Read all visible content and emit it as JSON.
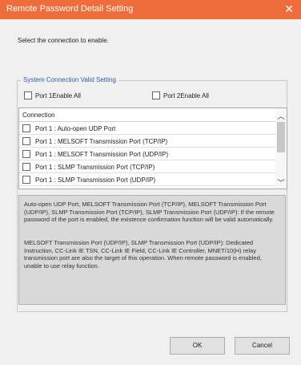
{
  "dialog": {
    "title": "Remote Password Detail Setting",
    "instruction": "Select the connection to enable."
  },
  "group": {
    "title": "System Connection Valid Setting",
    "port1_all_label": "Port 1Enable All",
    "port2_all_label": "Port 2Enable All"
  },
  "list": {
    "header": "Connection",
    "items": [
      {
        "label": "Port 1 : Auto-open UDP Port",
        "checked": false
      },
      {
        "label": "Port 1 : MELSOFT Transmission Port (TCP/IP)",
        "checked": false
      },
      {
        "label": "Port 1 : MELSOFT Transmission Port (UDP/IP)",
        "checked": false
      },
      {
        "label": "Port 1 : SLMP Transmission Port (TCP/IP)",
        "checked": false
      },
      {
        "label": "Port 1 : SLMP Transmission Port (UDP/IP)",
        "checked": false
      }
    ]
  },
  "description": {
    "p1": "Auto-open UDP Port, MELSOFT Transmission Port (TCP/IP), MELSOFT Transmission Port (UDP/IP), SLMP Transmission Port (TCP/IP), SLMP Transmission Port (UDP/IP): If the remote password of the port is enabled, the existence confirmation function will be valid automatically.",
    "p2": "MELSOFT Transmission Port (UDP/IP), SLMP Transmission Port (UDP/IP): Dedicated Instruction, CC-Link IE TSN, CC-Link IE Field, CC-Link IE Controller, MNET/10(H) relay transmission port are also the target of this operation. When remote password is enabled, unable to use relay function."
  },
  "buttons": {
    "ok": "OK",
    "cancel": "Cancel"
  },
  "icons": {
    "close": "close-icon",
    "scroll_up": "chevron-up-icon",
    "scroll_down": "chevron-down-icon"
  },
  "colors": {
    "titlebar": "#ee6d3a",
    "group_title": "#2d5ea6"
  }
}
